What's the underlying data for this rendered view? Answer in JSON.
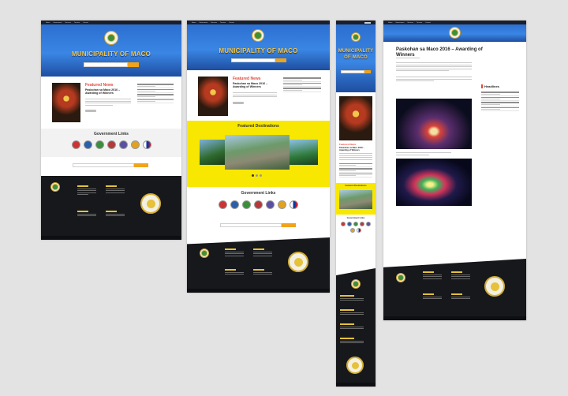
{
  "nav": {
    "items": [
      "Home",
      "Government",
      "Services",
      "Tourism",
      "Contact"
    ]
  },
  "hero": {
    "title": "MUNICIPALITY OF MACO"
  },
  "featured": {
    "heading": "Featured News",
    "article_title": "Paskohan sa Maco 2016 – Awarding of Winners"
  },
  "sections": {
    "gov_links": "Government Links",
    "destinations": "Featured Destinations"
  },
  "article": {
    "title": "Paskohan sa Maco 2016 – Awarding of Winners",
    "sidebar_heading": "Headlines"
  },
  "colors": {
    "hero_blue": "#2c6fd1",
    "accent_yellow": "#f8e700",
    "featured_red": "#e24a3b",
    "footer_dark": "#17181c",
    "button_orange": "#f0a31b"
  }
}
